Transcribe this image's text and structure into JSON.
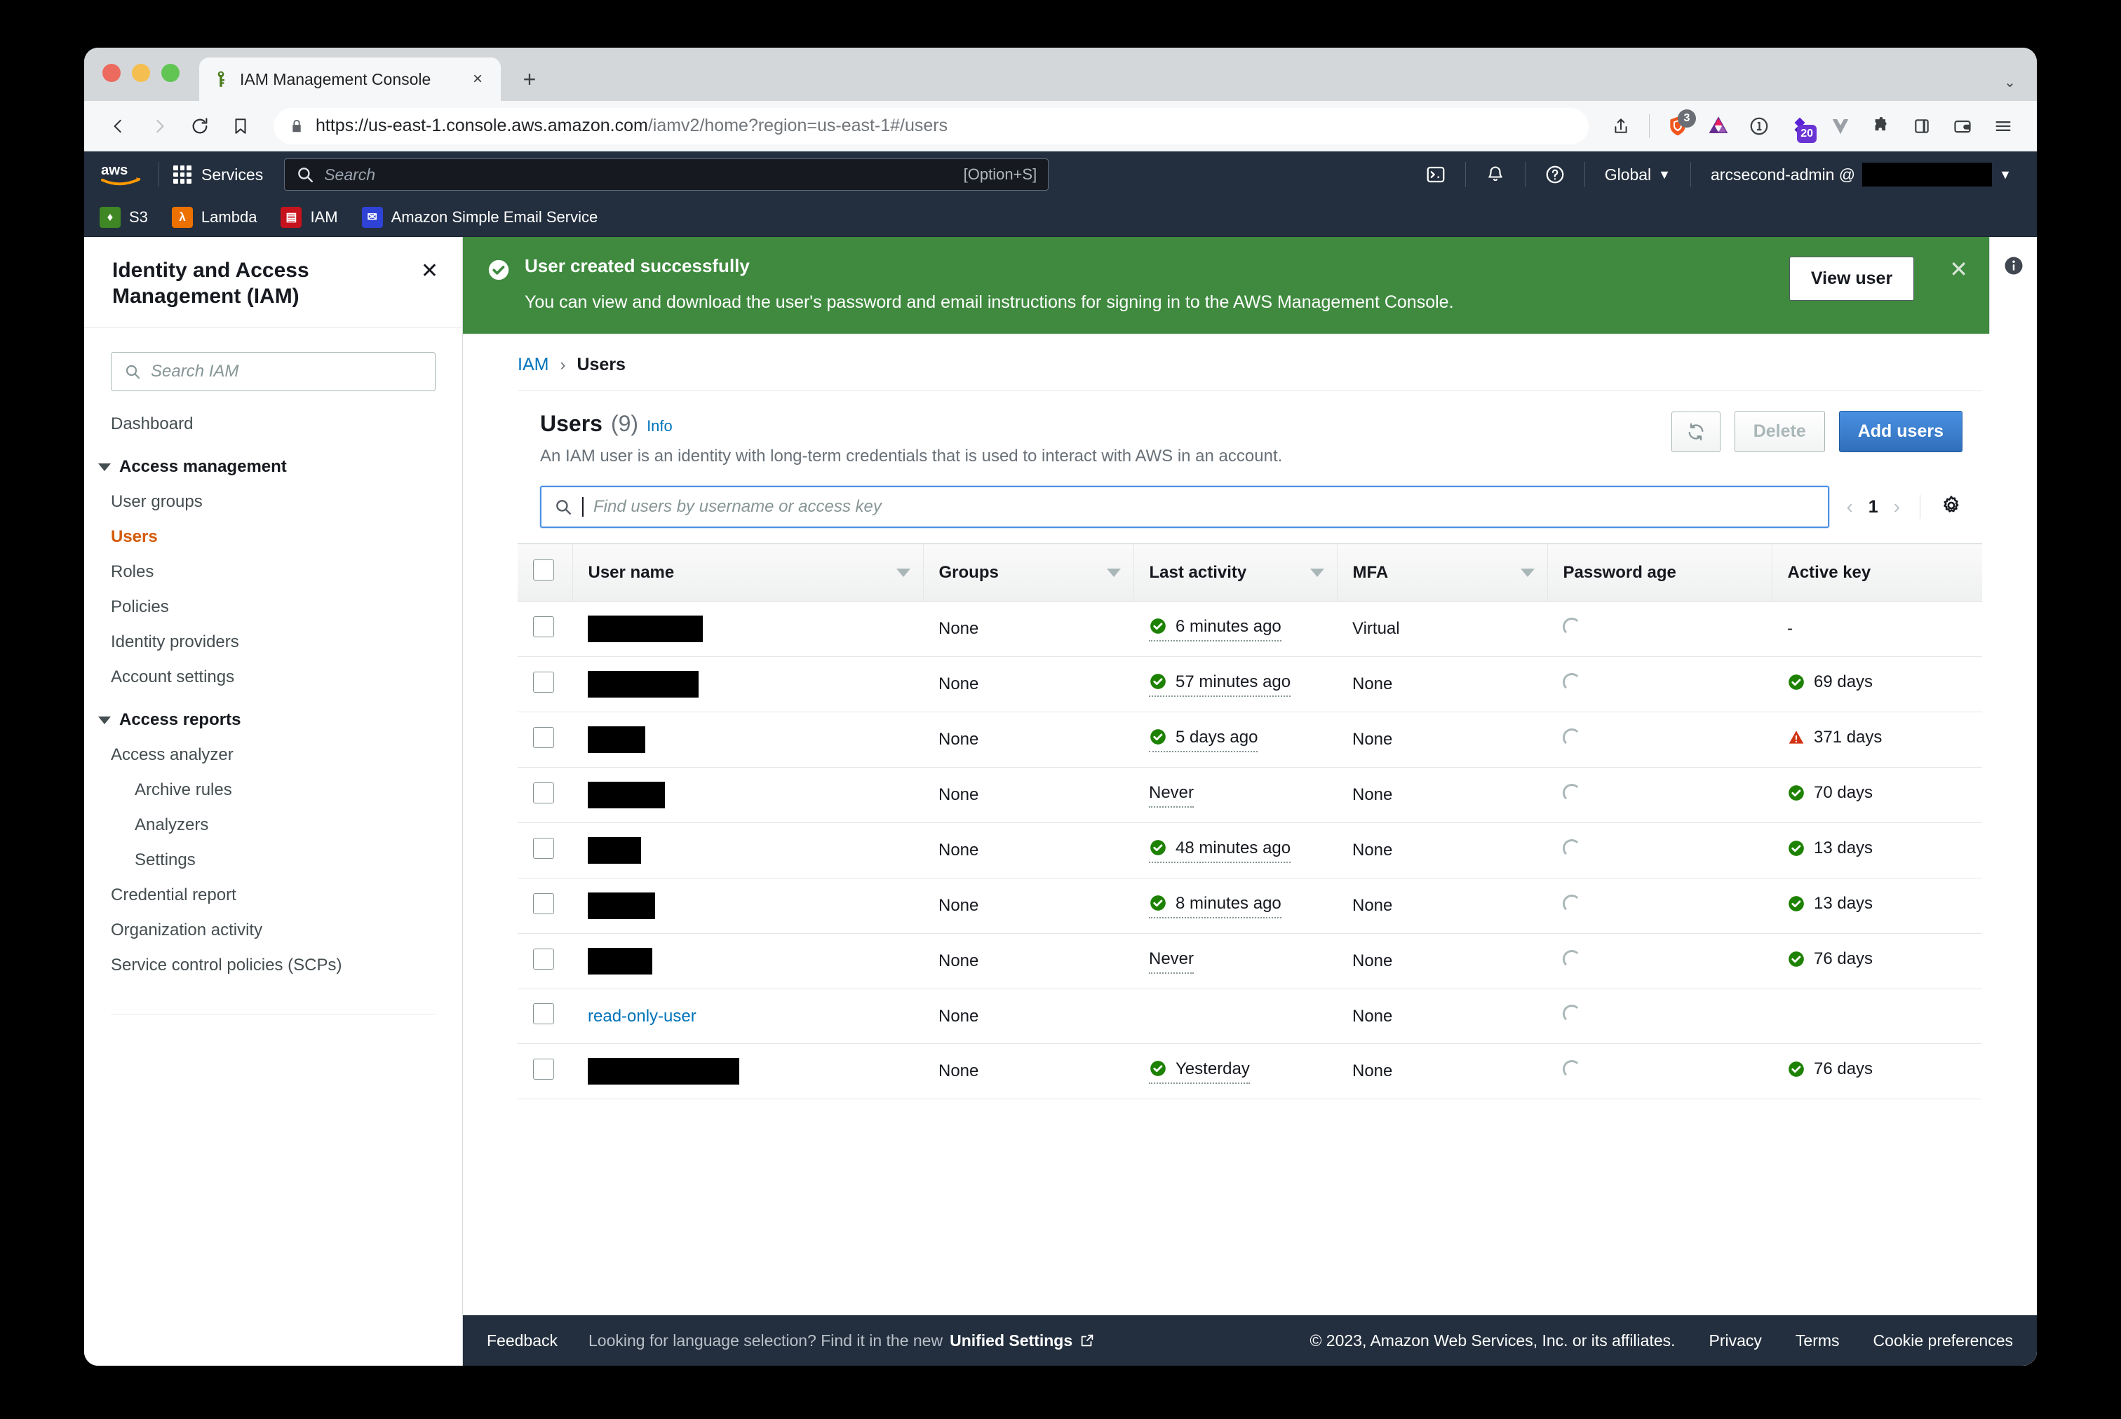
{
  "browser": {
    "tab_title": "IAM Management Console",
    "tab_favicon_name": "aws-iam-key-favicon",
    "new_tab_label": "+",
    "close_tab_label": "×",
    "tab_list_label": "⌄",
    "url_prefix": "https://us-east-1.console.aws.amazon.com",
    "url_path": "/iamv2/home?region=us-east-1#/users",
    "extension_badges": {
      "brave_shields": "3",
      "purple_ext": "20"
    }
  },
  "awsnav": {
    "services_label": "Services",
    "search_placeholder": "Search",
    "search_hint": "[Option+S]",
    "region_label": "Global",
    "region_caret": "▼",
    "account_label": "arcsecond-admin @",
    "account_caret": "▼",
    "icons": [
      "cloudshell-icon",
      "notifications-bell-icon",
      "help-question-icon"
    ]
  },
  "bookmarks": [
    {
      "label": "S3",
      "glyph": "🪣",
      "color": "#3f8624"
    },
    {
      "label": "Lambda",
      "glyph": "λ",
      "color": "#ed7100"
    },
    {
      "label": "IAM",
      "glyph": "▤",
      "color": "#c7131d"
    },
    {
      "label": "Amazon Simple Email Service",
      "glyph": "✉",
      "color": "#2f42d6"
    }
  ],
  "sidebar": {
    "title": "Identity and Access Management (IAM)",
    "close_label": "✕",
    "search_placeholder": "Search IAM",
    "items": [
      {
        "label": "Dashboard",
        "type": "item",
        "active": false
      },
      {
        "label": "Access management",
        "type": "group"
      },
      {
        "label": "User groups",
        "type": "item",
        "active": false
      },
      {
        "label": "Users",
        "type": "item",
        "active": true
      },
      {
        "label": "Roles",
        "type": "item",
        "active": false
      },
      {
        "label": "Policies",
        "type": "item",
        "active": false
      },
      {
        "label": "Identity providers",
        "type": "item",
        "active": false
      },
      {
        "label": "Account settings",
        "type": "item",
        "active": false
      },
      {
        "label": "Access reports",
        "type": "group"
      },
      {
        "label": "Access analyzer",
        "type": "item",
        "active": false
      },
      {
        "label": "Archive rules",
        "type": "subitem",
        "active": false
      },
      {
        "label": "Analyzers",
        "type": "subitem",
        "active": false
      },
      {
        "label": "Settings",
        "type": "subitem",
        "active": false
      },
      {
        "label": "Credential report",
        "type": "item",
        "active": false
      },
      {
        "label": "Organization activity",
        "type": "item",
        "active": false
      },
      {
        "label": "Service control policies (SCPs)",
        "type": "item",
        "active": false
      }
    ]
  },
  "flash": {
    "title": "User created successfully",
    "message": "You can view and download the user's password and email instructions for signing in to the AWS Management Console.",
    "button_label": "View user",
    "dismiss_label": "✕",
    "color": "#3f8a3f"
  },
  "breadcrumb": {
    "root": "IAM",
    "separator": "›",
    "current": "Users"
  },
  "users_panel": {
    "title": "Users",
    "count": "(9)",
    "info_label": "Info",
    "description": "An IAM user is an identity with long-term credentials that is used to interact with AWS in an account.",
    "refresh_label": "refresh-icon",
    "delete_label": "Delete",
    "add_users_label": "Add users",
    "find_placeholder": "Find users by username or access key",
    "page_number": "1",
    "prev_label": "‹",
    "next_label": "›",
    "settings_label": "gear-icon"
  },
  "table": {
    "columns": [
      {
        "label": "User name",
        "sortable": true
      },
      {
        "label": "Groups",
        "sortable": true
      },
      {
        "label": "Last activity",
        "sortable": true
      },
      {
        "label": "MFA",
        "sortable": true
      },
      {
        "label": "Password age",
        "sortable": false
      },
      {
        "label": "Active key",
        "sortable": false
      }
    ],
    "rows": [
      {
        "user_name": "",
        "redacted": true,
        "redact_width": 164,
        "groups": "None",
        "last_activity": "6 minutes ago",
        "activity_ok": true,
        "mfa": "Virtual",
        "password_age": "loading",
        "active_key": "-",
        "key_state": "none"
      },
      {
        "user_name": "",
        "redacted": true,
        "redact_width": 158,
        "groups": "None",
        "last_activity": "57 minutes ago",
        "activity_ok": true,
        "mfa": "None",
        "password_age": "loading",
        "active_key": "69 days",
        "key_state": "ok"
      },
      {
        "user_name": "",
        "redacted": true,
        "redact_width": 82,
        "groups": "None",
        "last_activity": "5 days ago",
        "activity_ok": true,
        "mfa": "None",
        "password_age": "loading",
        "active_key": "371 days",
        "key_state": "warn"
      },
      {
        "user_name": "",
        "redacted": true,
        "redact_width": 110,
        "groups": "None",
        "last_activity": "Never",
        "activity_ok": false,
        "mfa": "None",
        "password_age": "loading",
        "active_key": "70 days",
        "key_state": "ok"
      },
      {
        "user_name": "",
        "redacted": true,
        "redact_width": 76,
        "groups": "None",
        "last_activity": "48 minutes ago",
        "activity_ok": true,
        "mfa": "None",
        "password_age": "loading",
        "active_key": "13 days",
        "key_state": "ok"
      },
      {
        "user_name": "",
        "redacted": true,
        "redact_width": 96,
        "groups": "None",
        "last_activity": "8 minutes ago",
        "activity_ok": true,
        "mfa": "None",
        "password_age": "loading",
        "active_key": "13 days",
        "key_state": "ok"
      },
      {
        "user_name": "",
        "redacted": true,
        "redact_width": 92,
        "groups": "None",
        "last_activity": "Never",
        "activity_ok": false,
        "mfa": "None",
        "password_age": "loading",
        "active_key": "76 days",
        "key_state": "ok"
      },
      {
        "user_name": "read-only-user",
        "redacted": false,
        "redact_width": 0,
        "groups": "None",
        "last_activity": "",
        "activity_ok": false,
        "mfa": "None",
        "password_age": "loading",
        "active_key": "",
        "key_state": "none"
      },
      {
        "user_name": "",
        "redacted": true,
        "redact_width": 216,
        "groups": "None",
        "last_activity": "Yesterday",
        "activity_ok": true,
        "mfa": "None",
        "password_age": "loading",
        "active_key": "76 days",
        "key_state": "ok"
      }
    ]
  },
  "footer": {
    "feedback_label": "Feedback",
    "language_note_prefix": "Looking for language selection? Find it in the new ",
    "language_note_link": "Unified Settings",
    "copyright": "© 2023, Amazon Web Services, Inc. or its affiliates.",
    "links": [
      "Privacy",
      "Terms",
      "Cookie preferences"
    ]
  }
}
